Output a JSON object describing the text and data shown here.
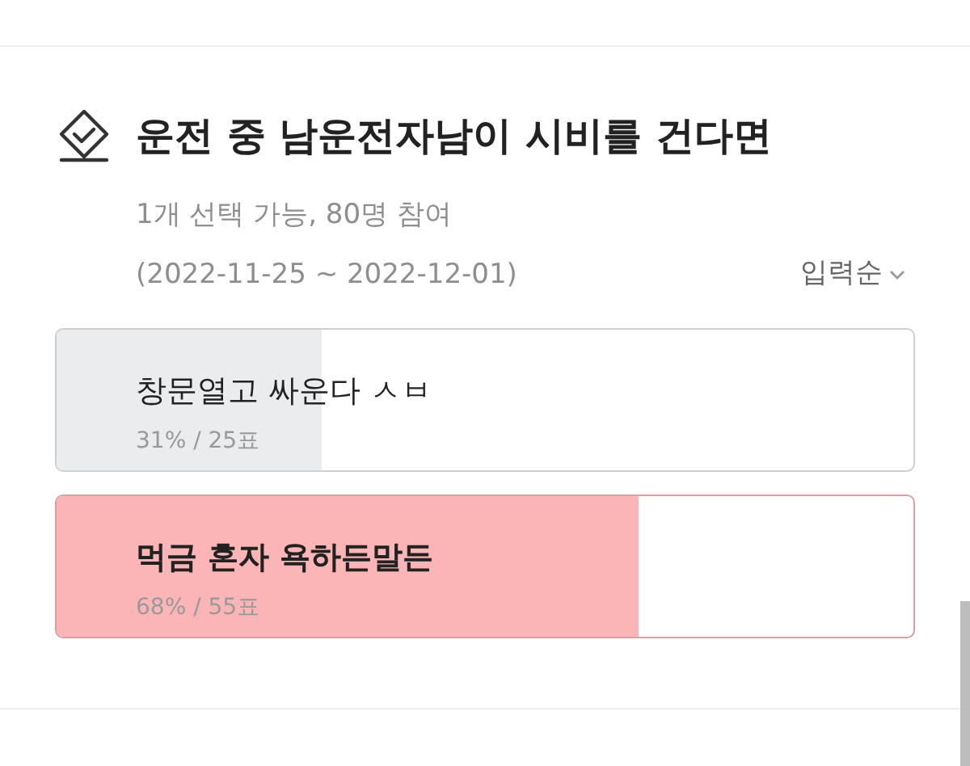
{
  "poll": {
    "title": "운전 중 남운전자남이 시비를 건다면",
    "meta": "1개 선택 가능, 80명 참여",
    "period": "(2022-11-25 ~ 2022-12-01)",
    "sort": {
      "label": "입력순"
    },
    "options": [
      {
        "label": "창문열고 싸운다 ㅅㅂ",
        "result": "31% / 25표",
        "level": 0.31,
        "selected": false
      },
      {
        "label": "먹금 혼자 욕하든말든",
        "result": "68% / 55표",
        "level": 0.68,
        "selected": true
      }
    ]
  }
}
